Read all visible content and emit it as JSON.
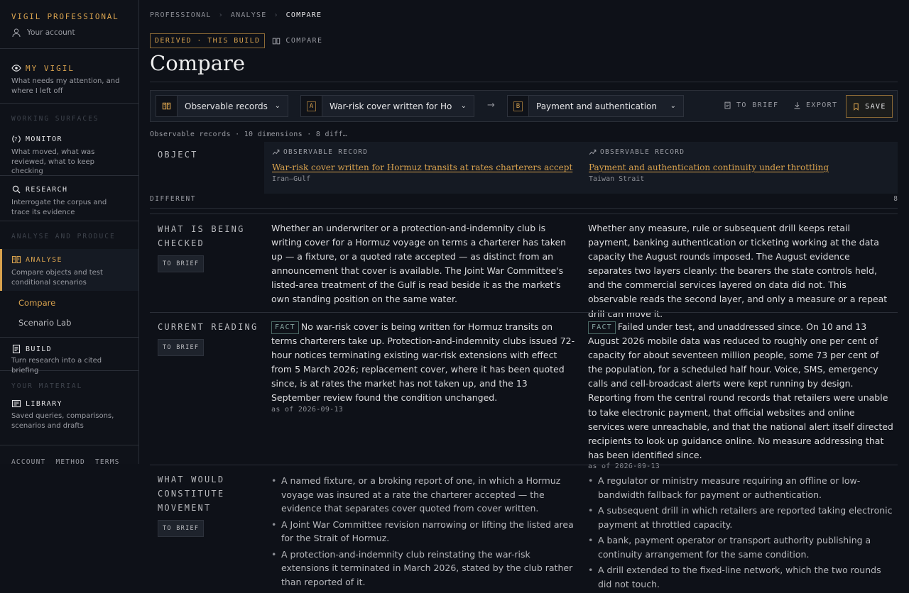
{
  "sidebar": {
    "brand": "VIGIL PROFESSIONAL",
    "account": "Your account",
    "my_vigil": {
      "title": "MY VIGIL",
      "sub": "What needs my attention, and where I left off"
    },
    "working_label": "WORKING SURFACES",
    "monitor": {
      "title": "MONITOR",
      "sub": "What moved, what was reviewed, what to keep checking"
    },
    "research": {
      "title": "RESEARCH",
      "sub": "Interrogate the corpus and trace its evidence"
    },
    "analyse_label": "ANALYSE AND PRODUCE",
    "analyse": {
      "title": "ANALYSE",
      "sub": "Compare objects and test conditional scenarios"
    },
    "subnav": [
      "Compare",
      "Scenario Lab"
    ],
    "build": {
      "title": "BUILD",
      "sub": "Turn research into a cited briefing"
    },
    "material_label": "YOUR MATERIAL",
    "library": {
      "title": "LIBRARY",
      "sub": "Saved queries, comparisons, scenarios and drafts"
    },
    "footer": [
      "ACCOUNT",
      "METHOD",
      "TERMS"
    ]
  },
  "breadcrumb": [
    "PROFESSIONAL",
    "ANALYSE",
    "COMPARE"
  ],
  "tags": {
    "derived": "DERIVED · THIS BUILD",
    "compare": "COMPARE"
  },
  "page_title": "Compare",
  "toolbar": {
    "kind_select": "Observable records",
    "a_badge": "A",
    "a_select": "War-risk cover written for Hormuz transits at rates charterers accept",
    "b_badge": "B",
    "b_select": "Payment and authentication continuity under throttling",
    "arrow": "→",
    "to_brief": "TO BRIEF",
    "export": "EXPORT",
    "save": "SAVE"
  },
  "summary": "Observable records · 10 dimensions · 8 diff…",
  "object": {
    "label": "OBJECT",
    "a": {
      "kind": "OBSERVABLE RECORD",
      "title": "War-risk cover written for Hormuz transits at rates charterers accept",
      "region": "Iran–Gulf"
    },
    "b": {
      "kind": "OBSERVABLE RECORD",
      "title": "Payment and authentication continuity under throttling",
      "region": "Taiwan Strait"
    }
  },
  "different": {
    "label": "DIFFERENT",
    "count": "8"
  },
  "to_brief_tag": "TO BRIEF",
  "fact_tag": "FACT",
  "rows": {
    "checked": {
      "label_lines": [
        "WHAT IS BEING",
        "CHECKED"
      ],
      "a": "Whether an underwriter or a protection-and-indemnity club is writing cover for a Hormuz voyage on terms a charterer has taken up — a fixture, or a quoted rate accepted — as distinct from an announcement that cover is available. The Joint War Committee's listed-area treatment of the Gulf is read beside it as the market's own standing position on the same water.",
      "b": "Whether any measure, rule or subsequent drill keeps retail payment, banking authentication or ticketing working at the data capacity the August rounds imposed. The August evidence separates two layers cleanly: the bearers the state controls held, and the commercial services layered on data did not. This observable reads the second layer, and only a measure or a repeat drill can move it."
    },
    "reading": {
      "label": "CURRENT READING",
      "a": "No war-risk cover is being written for Hormuz transits on terms charterers take up. Protection-and-indemnity clubs issued 72-hour notices terminating existing war-risk extensions with effect from 5 March 2026; replacement cover, where it has been quoted since, is at rates the market has not taken up, and the 13 September review found the condition unchanged.",
      "a_asof": "as of 2026-09-13",
      "b": "Failed under test, and unaddressed since. On 10 and 13 August 2026 mobile data was reduced to roughly one per cent of capacity for about seventeen million people, some 73 per cent of the population, for a scheduled half hour. Voice, SMS, emergency calls and cell-broadcast alerts were kept running by design. Reporting from the central round records that retailers were unable to take electronic payment, that official websites and online services were unreachable, and that the national alert itself directed recipients to look up guidance online. No measure addressing that has been identified since.",
      "b_asof": "as of 2026-09-13"
    },
    "movement": {
      "label_lines": [
        "WHAT WOULD",
        "CONSTITUTE",
        "MOVEMENT"
      ],
      "a": [
        "A named fixture, or a broking report of one, in which a Hormuz voyage was insured at a rate the charterer accepted — the evidence that separates cover quoted from cover written.",
        "A Joint War Committee revision narrowing or lifting the listed area for the Strait of Hormuz.",
        "A protection-and-indemnity club reinstating the war-risk extensions it terminated in March 2026, stated by the club rather than reported of it."
      ],
      "b": [
        "A regulator or ministry measure requiring an offline or low-bandwidth fallback for payment or authentication.",
        "A subsequent drill in which retailers are reported taking electronic payment at throttled capacity.",
        "A bank, payment operator or transport authority publishing a continuity arrangement for the same condition.",
        "A drill extended to the fixed-line network, which the two rounds did not touch."
      ]
    }
  },
  "colors": {
    "accent": "#d8a24e",
    "background": "#0e1118",
    "panel": "#151a23",
    "fact": "#86a6a1"
  }
}
